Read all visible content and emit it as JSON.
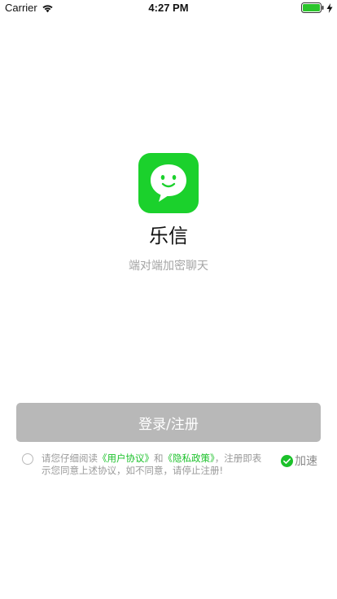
{
  "status_bar": {
    "carrier": "Carrier",
    "time": "4:27 PM",
    "wifi_icon": "wifi-icon",
    "battery_icon": "battery-full-icon",
    "charge_icon": "charging-bolt-icon"
  },
  "app": {
    "logo_icon": "chat-bubble-smile-icon",
    "name": "乐信",
    "tagline": "端对端加密聊天",
    "brand_color": "#1bd12c"
  },
  "login_button": {
    "label": "登录/注册",
    "color": "#b8b8b8"
  },
  "agreement": {
    "checked": false,
    "prefix": "请您仔细阅读",
    "user_agreement": "《用户协议》",
    "conjunction": "和",
    "privacy_policy": "《隐私政策》",
    "suffix": "，注册即表示您同意上述协议，如不同意，请停止注册!",
    "link_color": "#1bc12a"
  },
  "accelerate": {
    "label": "加速",
    "checked": true,
    "icon": "check-circle-icon"
  }
}
